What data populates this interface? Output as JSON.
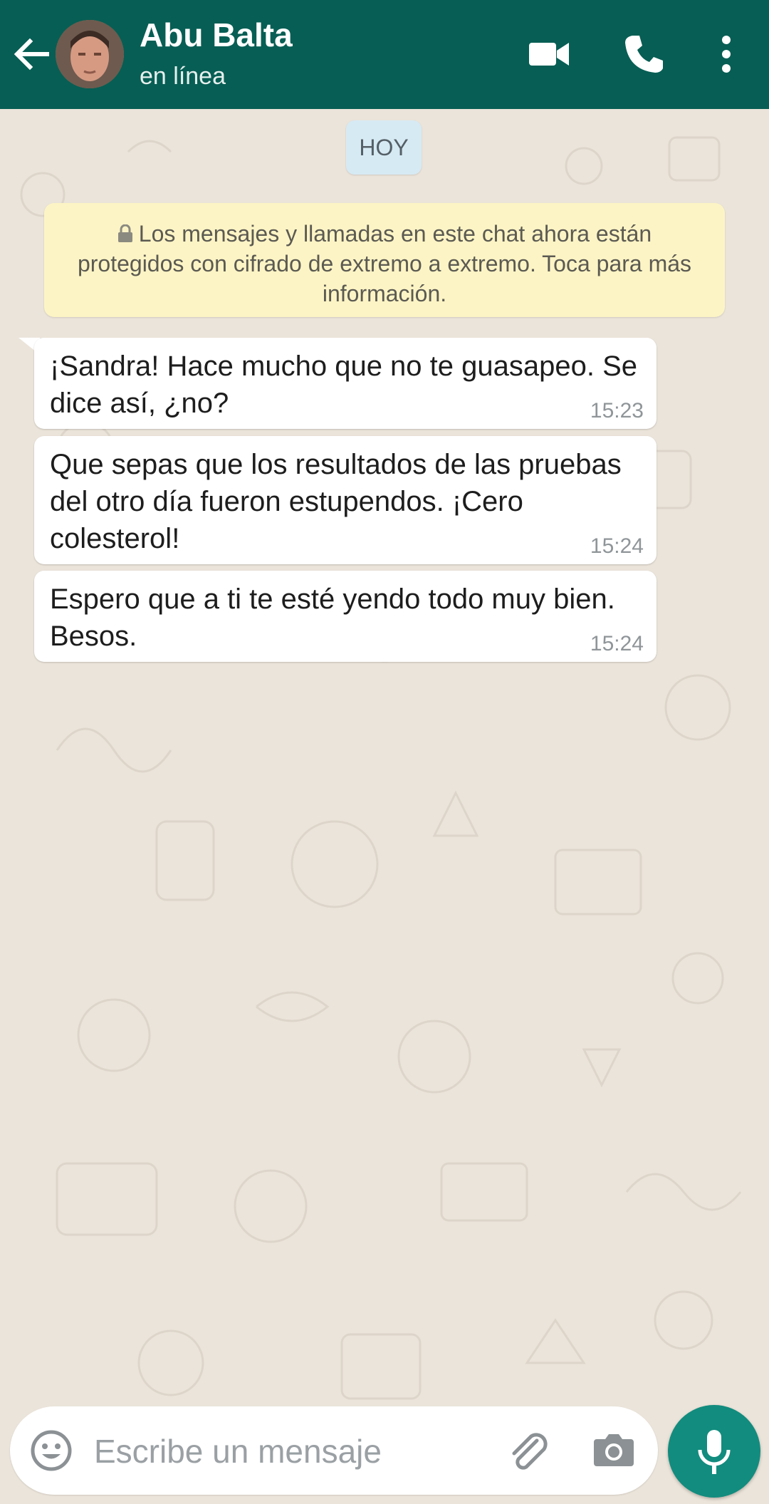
{
  "header": {
    "contact_name": "Abu Balta",
    "contact_status": "en línea",
    "icons": [
      "back-arrow-icon",
      "video-call-icon",
      "phone-call-icon",
      "more-options-icon"
    ],
    "background_color": "#075e54"
  },
  "chat": {
    "date_label": "HOY",
    "encryption_notice": "Los mensajes y llamadas en este chat ahora están protegidos con cifrado de extremo a extremo. Toca para más información.",
    "messages": [
      {
        "text": "¡Sandra! Hace mucho que no te guasapeo. Se dice así, ¿no?",
        "time": "15:23"
      },
      {
        "text": "Que sepas que los resultados de las pruebas del otro día fueron estupendos. ¡Cero colesterol!",
        "time": "15:24"
      },
      {
        "text": "Espero que a ti te esté yendo todo muy bien. Besos.",
        "time": "15:24"
      }
    ]
  },
  "composer": {
    "placeholder": "Escribe un mensaje",
    "icons": [
      "emoji-icon",
      "attach-icon",
      "camera-icon",
      "microphone-icon"
    ],
    "accent_color": "#128c7e"
  }
}
